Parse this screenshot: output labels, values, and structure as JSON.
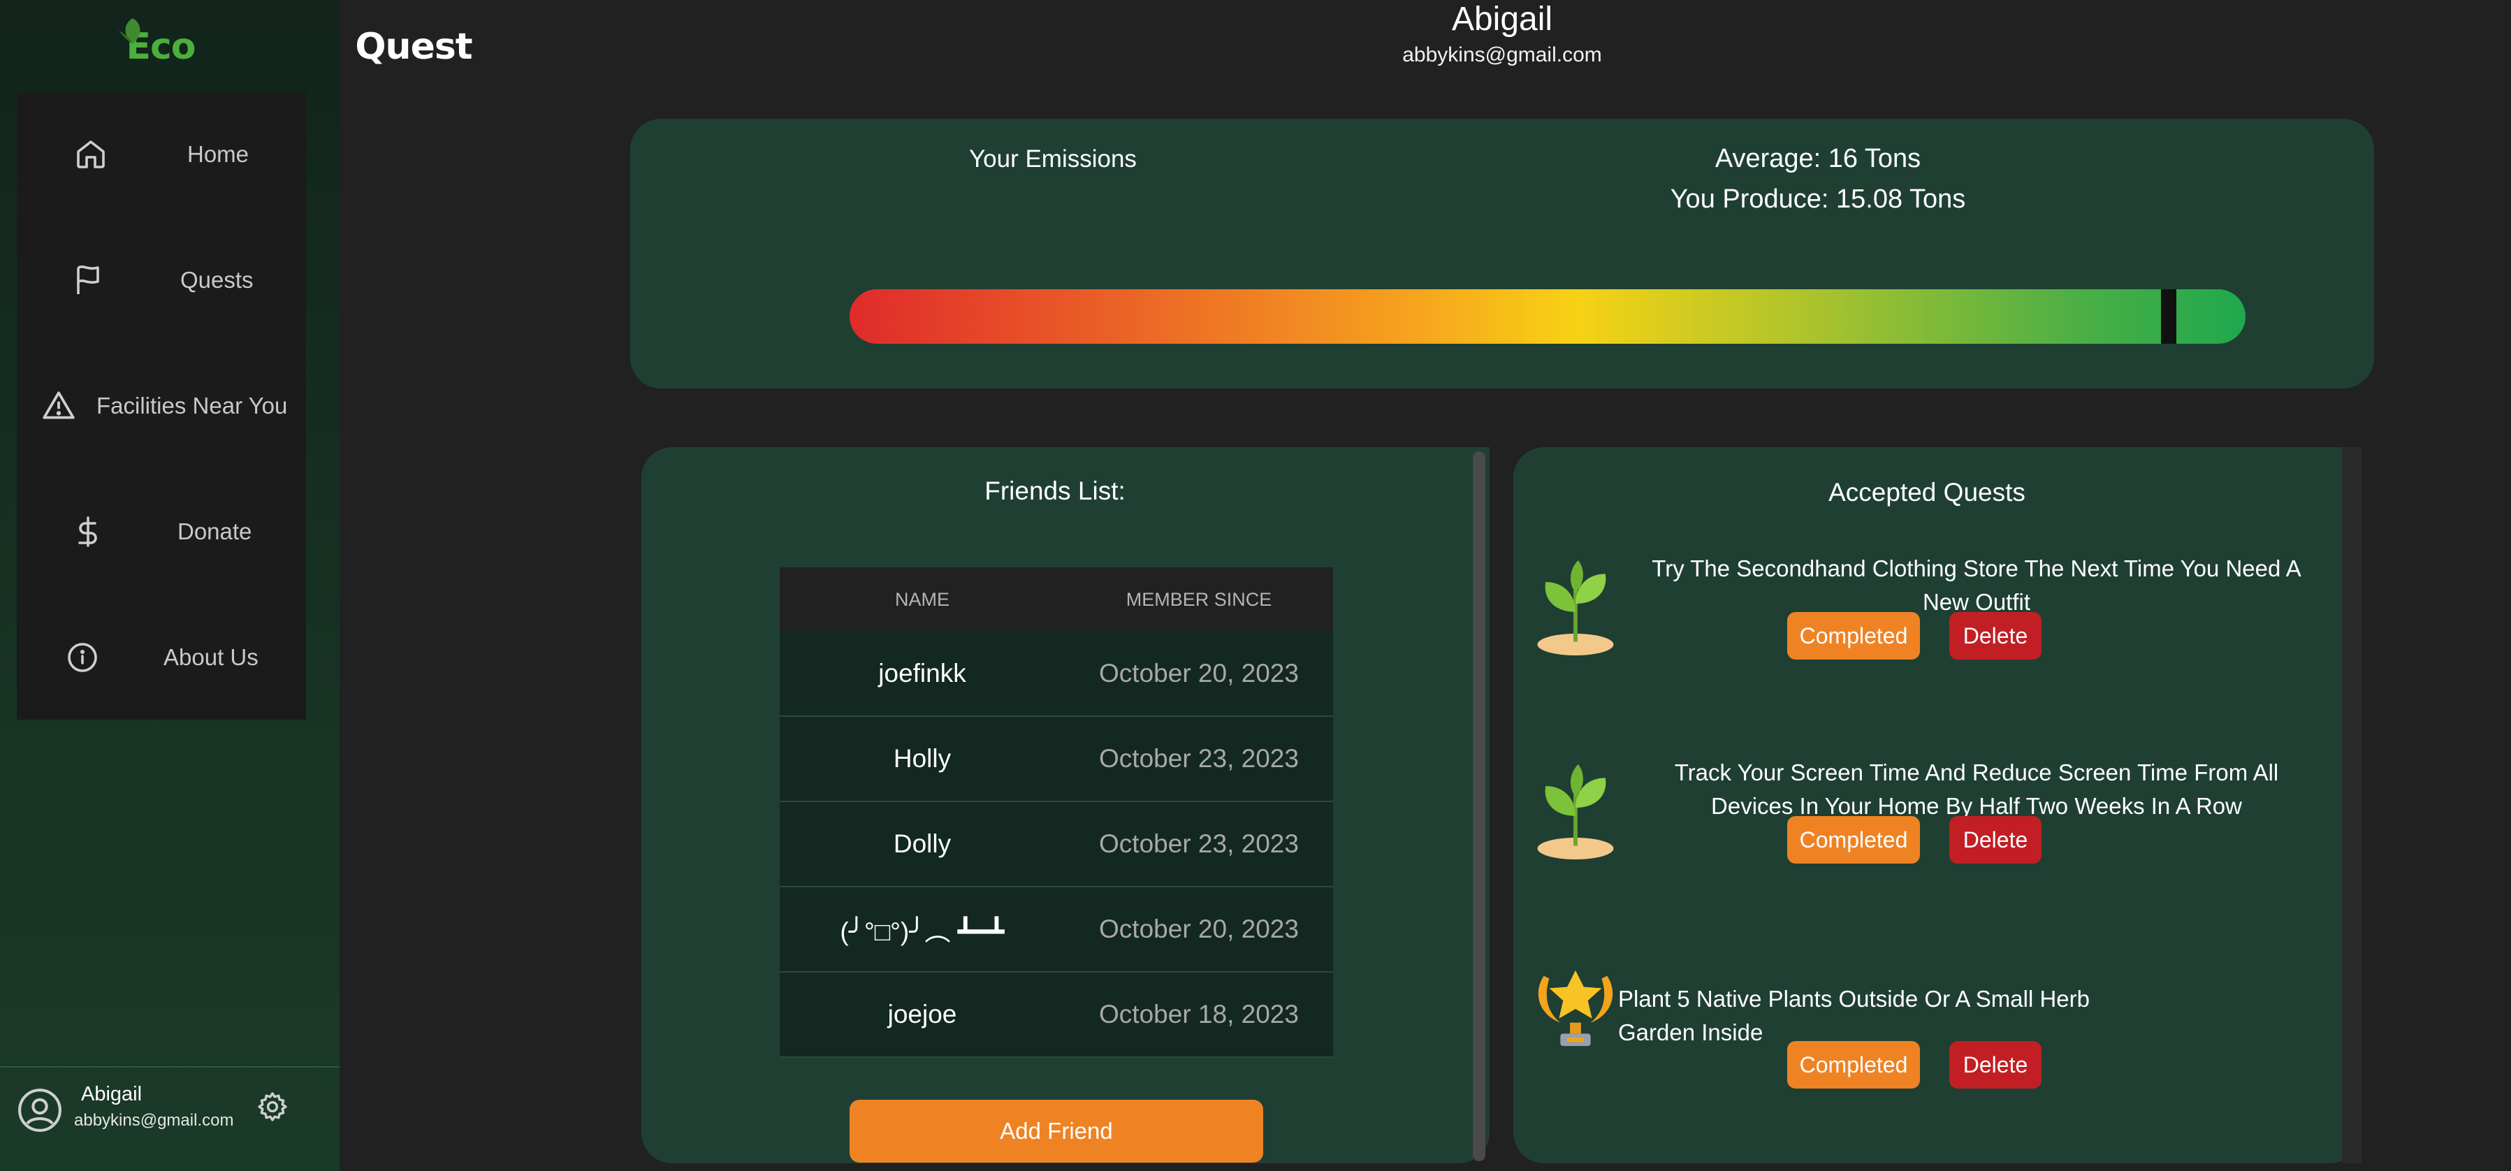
{
  "app": {
    "logo_part1": "Eco",
    "logo_part2": "Quest"
  },
  "sidebar": {
    "items": [
      {
        "label": "Home",
        "icon": "home-icon"
      },
      {
        "label": "Quests",
        "icon": "flag-icon"
      },
      {
        "label": "Facilities Near You",
        "icon": "warning-icon"
      },
      {
        "label": "Donate",
        "icon": "dollar-icon"
      },
      {
        "label": "About Us",
        "icon": "info-icon"
      }
    ],
    "user": {
      "name": "Abigail",
      "email": "abbykins@gmail.com"
    }
  },
  "profile": {
    "name": "Abigail",
    "email": "abbykins@gmail.com"
  },
  "emissions": {
    "title": "Your Emissions",
    "average_label": "Average: 16 Tons",
    "produce_label": "You Produce: 15.08 Tons",
    "marker_fraction": 0.945,
    "colors": [
      "#e02b2b",
      "#f7d214",
      "#1fa84d"
    ]
  },
  "friends": {
    "title": "Friends List:",
    "headers": [
      "NAME",
      "MEMBER SINCE"
    ],
    "rows": [
      {
        "name": "joefinkk",
        "since": "October 20, 2023"
      },
      {
        "name": "Holly",
        "since": "October 23, 2023"
      },
      {
        "name": "Dolly",
        "since": "October 23, 2023"
      },
      {
        "name": "(╯°□°)╯︵ ┻━┻",
        "since": "October 20, 2023"
      },
      {
        "name": "joejoe",
        "since": "October 18, 2023"
      }
    ],
    "add_button": "Add Friend"
  },
  "quests": {
    "title": "Accepted Quests",
    "items": [
      {
        "text": "Try The Secondhand Clothing Store The Next Time You Need A New Outfit",
        "icon": "sprout-icon"
      },
      {
        "text": "Track Your Screen Time And Reduce Screen Time From All Devices In Your Home By Half Two Weeks In A Row",
        "icon": "sprout-icon"
      },
      {
        "text": "Plant 5 Native Plants Outside Or A Small Herb Garden Inside",
        "icon": "trophy-icon"
      }
    ],
    "completed_label": "Completed",
    "delete_label": "Delete"
  }
}
